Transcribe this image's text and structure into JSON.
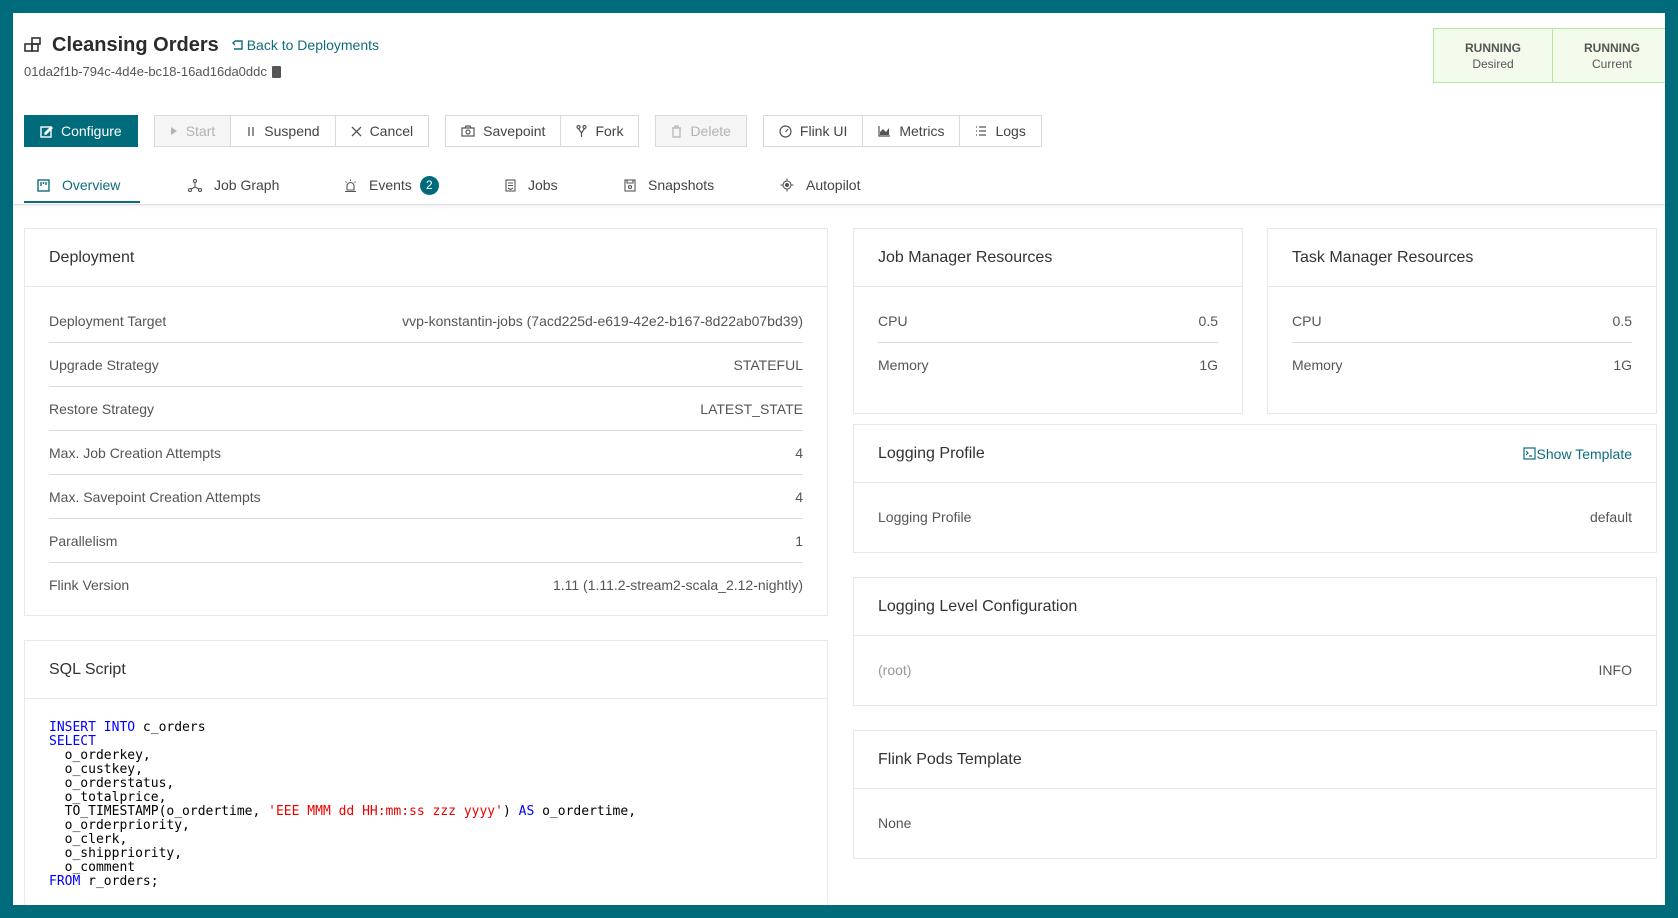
{
  "header": {
    "title": "Cleansing Orders",
    "back_link": "Back to Deployments",
    "deployment_id": "01da2f1b-794c-4d4e-bc18-16ad16da0ddc"
  },
  "status": {
    "desired_state": "RUNNING",
    "desired_label": "Desired",
    "current_state": "RUNNING",
    "current_label": "Current",
    "colors": {
      "border": "#b7e59b",
      "background": "#f3fcec"
    }
  },
  "toolbar": {
    "configure": "Configure",
    "start": "Start",
    "suspend": "Suspend",
    "cancel": "Cancel",
    "savepoint": "Savepoint",
    "fork": "Fork",
    "delete": "Delete",
    "flink_ui": "Flink UI",
    "metrics": "Metrics",
    "logs": "Logs"
  },
  "tabs": [
    {
      "label": "Overview",
      "icon": "overview-icon",
      "active": true
    },
    {
      "label": "Job Graph",
      "icon": "job-graph-icon"
    },
    {
      "label": "Events",
      "icon": "alarm-icon",
      "badge": "2"
    },
    {
      "label": "Jobs",
      "icon": "jobs-icon"
    },
    {
      "label": "Snapshots",
      "icon": "snapshot-icon"
    },
    {
      "label": "Autopilot",
      "icon": "autopilot-icon"
    }
  ],
  "deployment": {
    "title": "Deployment",
    "rows": [
      {
        "label": "Deployment Target",
        "value": "vvp-konstantin-jobs (7acd225d-e619-42e2-b167-8d22ab07bd39)"
      },
      {
        "label": "Upgrade Strategy",
        "value": "STATEFUL"
      },
      {
        "label": "Restore Strategy",
        "value": "LATEST_STATE"
      },
      {
        "label": "Max. Job Creation Attempts",
        "value": "4"
      },
      {
        "label": "Max. Savepoint Creation Attempts",
        "value": "4"
      },
      {
        "label": "Parallelism",
        "value": "1"
      },
      {
        "label": "Flink Version",
        "value": "1.11 (1.11.2-stream2-scala_2.12-nightly)"
      }
    ]
  },
  "job_manager": {
    "title": "Job Manager Resources",
    "rows": [
      {
        "label": "CPU",
        "value": "0.5"
      },
      {
        "label": "Memory",
        "value": "1G"
      }
    ]
  },
  "task_manager": {
    "title": "Task Manager Resources",
    "rows": [
      {
        "label": "CPU",
        "value": "0.5"
      },
      {
        "label": "Memory",
        "value": "1G"
      }
    ]
  },
  "logging_profile": {
    "title": "Logging Profile",
    "show_template": "Show Template",
    "rows": [
      {
        "label": "Logging Profile",
        "value": "default"
      }
    ]
  },
  "logging_level": {
    "title": "Logging Level Configuration",
    "rows": [
      {
        "label": "(root)",
        "value": "INFO"
      }
    ]
  },
  "pods_template": {
    "title": "Flink Pods Template",
    "value": "None"
  },
  "sql": {
    "title": "SQL Script",
    "lines": [
      [
        {
          "t": "INSERT INTO",
          "k": "kw"
        },
        {
          "t": " c_orders"
        }
      ],
      [
        {
          "t": "SELECT",
          "k": "kw"
        }
      ],
      [
        {
          "t": "  o_orderkey,"
        }
      ],
      [
        {
          "t": "  o_custkey,"
        }
      ],
      [
        {
          "t": "  o_orderstatus,"
        }
      ],
      [
        {
          "t": "  o_totalprice,"
        }
      ],
      [
        {
          "t": "  TO_TIMESTAMP(o_ordertime, "
        },
        {
          "t": "'EEE MMM dd HH:mm:ss zzz yyyy'",
          "k": "str"
        },
        {
          "t": ") "
        },
        {
          "t": "AS",
          "k": "kw"
        },
        {
          "t": " o_ordertime,"
        }
      ],
      [
        {
          "t": "  o_orderpriority,"
        }
      ],
      [
        {
          "t": "  o_clerk,"
        }
      ],
      [
        {
          "t": "  o_shippriority,"
        }
      ],
      [
        {
          "t": "  o_comment"
        }
      ],
      [
        {
          "t": "FROM",
          "k": "kw"
        },
        {
          "t": " r_orders;"
        }
      ]
    ]
  },
  "colors": {
    "accent": "#006b7a",
    "link": "#0f6c7c",
    "keyword": "#0000ff",
    "string": "#ee0000"
  }
}
